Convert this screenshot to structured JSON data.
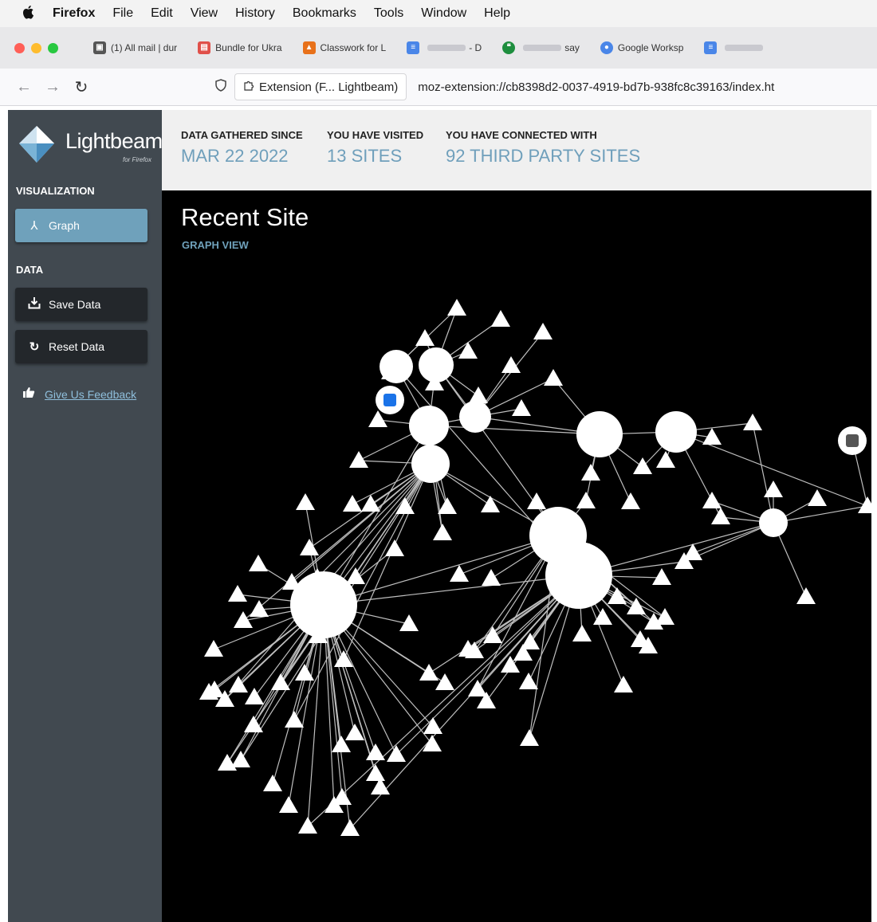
{
  "menubar": {
    "apple": "",
    "items": [
      "Firefox",
      "File",
      "Edit",
      "View",
      "History",
      "Bookmarks",
      "Tools",
      "Window",
      "Help"
    ]
  },
  "tabs": [
    {
      "label": "(1) All mail | dur",
      "icon": "mail-icon",
      "color": "#555555"
    },
    {
      "label": "Bundle for Ukra",
      "icon": "bundle-icon",
      "color": "#e0504a"
    },
    {
      "label": "Classwork for L",
      "icon": "classroom-icon",
      "color": "#e8711a"
    },
    {
      "label": "- D",
      "icon": "docs-icon",
      "color": "#4a86e8"
    },
    {
      "label": "say",
      "icon": "hangouts-icon",
      "color": "#1e8e3e"
    },
    {
      "label": "Google Worksp",
      "icon": "workspace-icon",
      "color": "#4a86e8"
    },
    {
      "label": "",
      "icon": "docs-icon",
      "color": "#4a86e8"
    }
  ],
  "nav": {
    "extension_label": "Extension (F... Lightbeam)",
    "url": "moz-extension://cb8398d2-0037-4919-bd7b-938fc8c39163/index.ht"
  },
  "sidebar": {
    "logo_title": "Lightbeam",
    "logo_sub": "for Firefox",
    "visualization_heading": "VISUALIZATION",
    "graph_button": "Graph",
    "data_heading": "DATA",
    "save_button": "Save Data",
    "reset_button": "Reset Data",
    "feedback_link": "Give Us Feedback"
  },
  "stats": {
    "since_label": "DATA GATHERED SINCE",
    "since_value": "MAR 22 2022",
    "visited_label": "YOU HAVE VISITED",
    "visited_value": "13 SITES",
    "connected_label": "YOU HAVE CONNECTED WITH",
    "connected_value": "92 THIRD PARTY SITES"
  },
  "graph": {
    "title": "Recent Site",
    "subtitle": "GRAPH VIEW"
  },
  "colors": {
    "accent": "#6fa1bb",
    "sidebar": "#414950",
    "dark_button": "#23272b"
  }
}
